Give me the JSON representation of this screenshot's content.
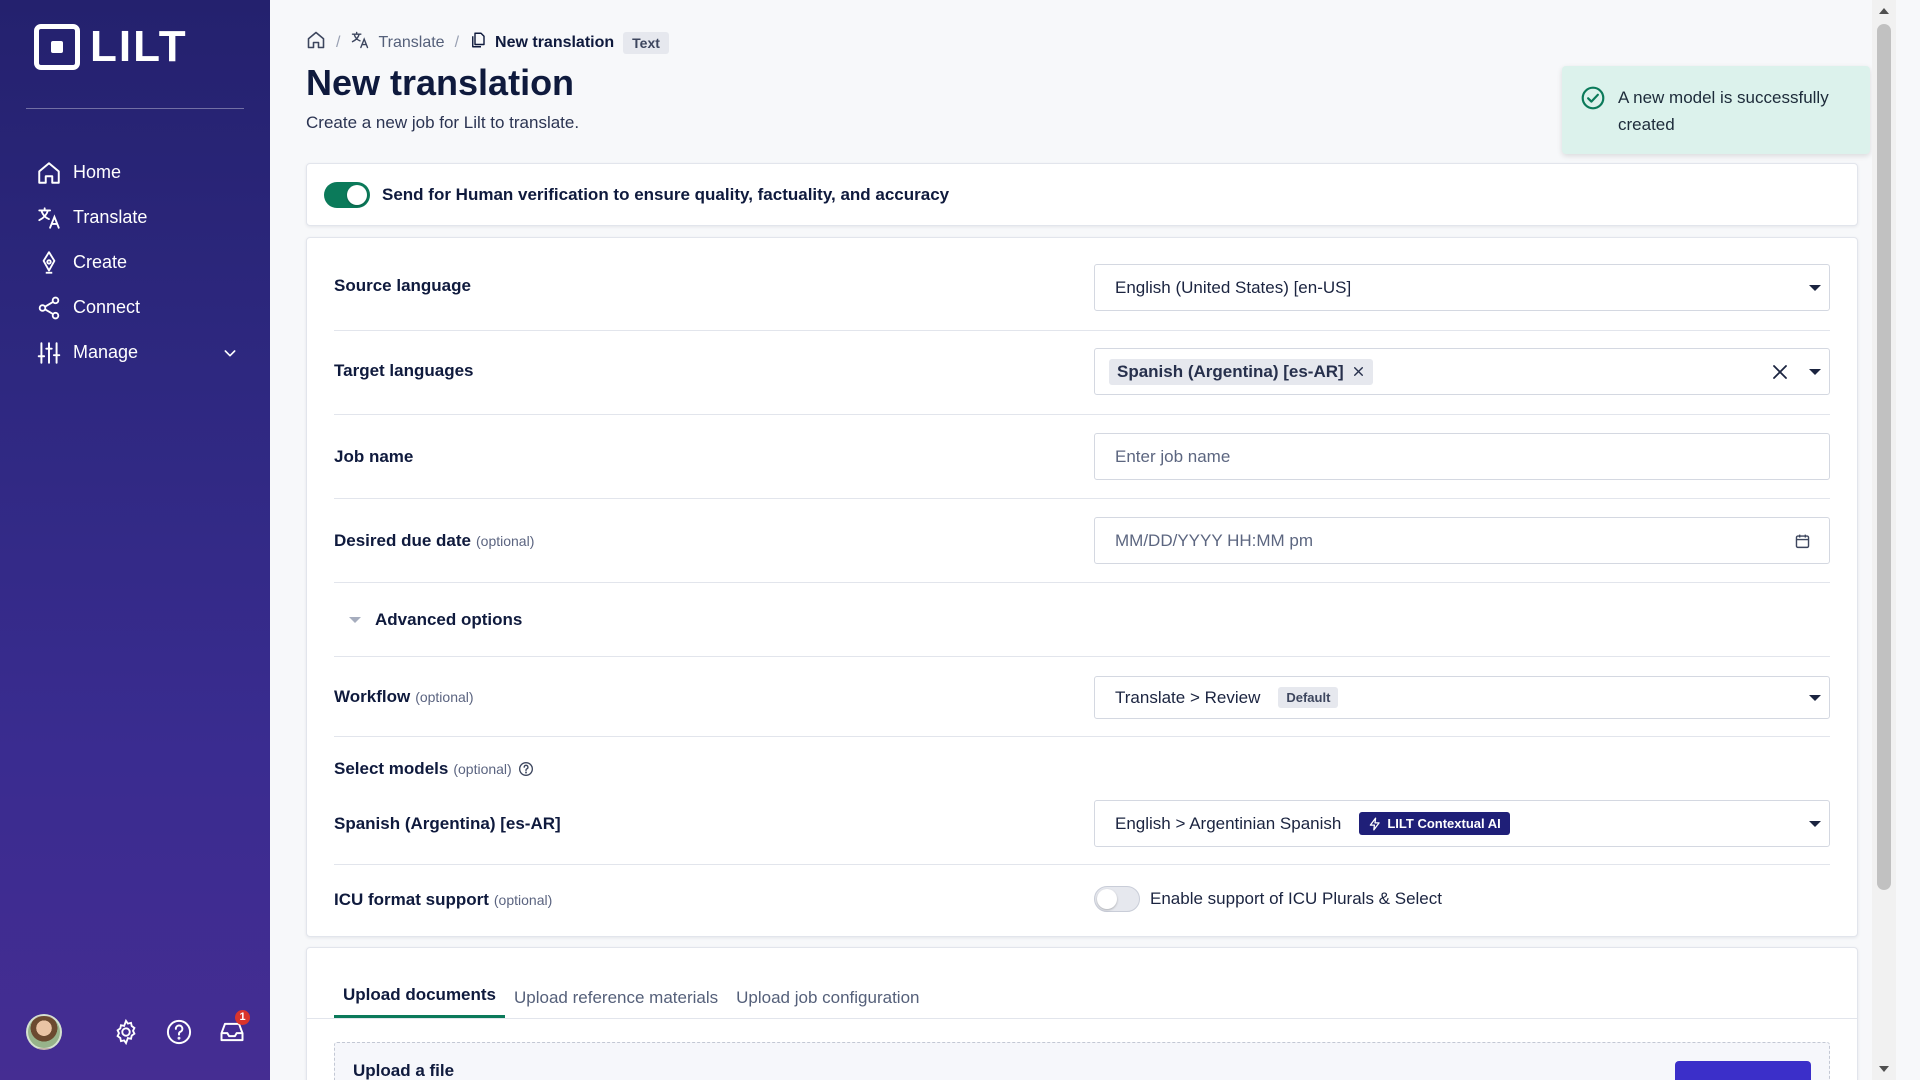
{
  "sidebar": {
    "logo_text": "LILT",
    "items": [
      {
        "label": "Home",
        "icon": "home-icon"
      },
      {
        "label": "Translate",
        "icon": "translate-icon"
      },
      {
        "label": "Create",
        "icon": "pen-nib-icon"
      },
      {
        "label": "Connect",
        "icon": "share-nodes-icon"
      },
      {
        "label": "Manage",
        "icon": "sliders-icon"
      }
    ],
    "footer": {
      "inbox_badge": "1"
    }
  },
  "breadcrumb": {
    "translate": "Translate",
    "current": "New translation",
    "current_tag": "Text"
  },
  "page": {
    "title": "New translation",
    "subtitle": "Create a new job for Lilt to translate."
  },
  "toast": {
    "message": "A new model is successfully created",
    "color": "#dcf2ec"
  },
  "verification": {
    "label": "Send for Human verification to ensure quality, factuality, and accuracy",
    "enabled": true
  },
  "form": {
    "source_language": {
      "label": "Source language",
      "value": "English (United States) [en-US]"
    },
    "target_languages": {
      "label": "Target languages",
      "chips": [
        "Spanish (Argentina) [es-AR]"
      ]
    },
    "job_name": {
      "label": "Job name",
      "placeholder": "Enter job name"
    },
    "due_date": {
      "label": "Desired due date",
      "optional": "(optional)",
      "placeholder": "MM/DD/YYYY HH:MM pm"
    },
    "advanced_options": "Advanced options",
    "workflow": {
      "label": "Workflow",
      "optional": "(optional)",
      "value": "Translate > Review",
      "tag": "Default"
    },
    "select_models": {
      "label": "Select models",
      "optional": "(optional)"
    },
    "model_row": {
      "label": "Spanish (Argentina) [es-AR]",
      "value": "English > Argentinian Spanish",
      "tag": "LILT Contextual AI"
    },
    "icu": {
      "label": "ICU format support",
      "optional": "(optional)",
      "toggle_label": "Enable support of ICU Plurals & Select",
      "enabled": false
    }
  },
  "uploads": {
    "tabs": [
      "Upload documents",
      "Upload reference materials",
      "Upload job configuration"
    ],
    "active_tab": 0,
    "drop_title": "Upload a file"
  },
  "colors": {
    "accent": "#0b7a5a",
    "brand": "#24216e",
    "ai_tag": "#1f1f78"
  }
}
